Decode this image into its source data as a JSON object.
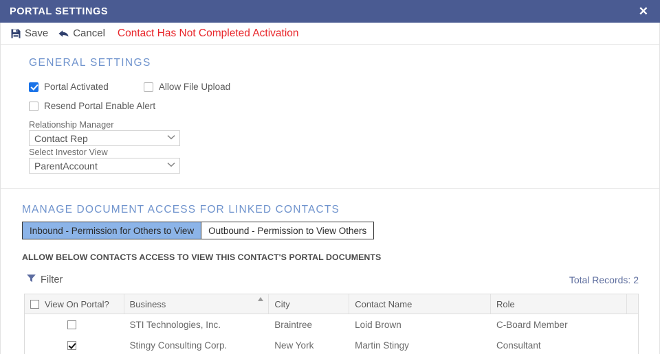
{
  "titlebar": {
    "title": "PORTAL SETTINGS",
    "close_icon": "close-icon",
    "close_glyph": "✕",
    "bg_color": "#4a5b92"
  },
  "toolbar": {
    "save_label": "Save",
    "save_icon": "save-floppy-icon",
    "cancel_label": "Cancel",
    "cancel_icon": "back-arrow-icon",
    "warning_text": "Contact Has Not Completed Activation",
    "warning_color": "#e8252a"
  },
  "general_settings": {
    "heading": "GENERAL SETTINGS",
    "heading_color": "#6f93cd",
    "portal_activated": {
      "label": "Portal Activated",
      "checked": true
    },
    "allow_file_upload": {
      "label": "Allow File Upload",
      "checked": false
    },
    "resend_portal_enable_alert": {
      "label": "Resend Portal Enable Alert",
      "checked": false
    },
    "relationship_manager": {
      "label": "Relationship Manager",
      "value": "Contact Rep"
    },
    "select_investor_view": {
      "label": "Select Investor View",
      "value": "ParentAccount"
    }
  },
  "manage_access": {
    "heading": "MANAGE DOCUMENT ACCESS FOR LINKED CONTACTS",
    "tabs": [
      {
        "label": "Inbound - Permission for Others to View",
        "active": true
      },
      {
        "label": "Outbound - Permission to View Others",
        "active": false
      }
    ],
    "active_tab_color": "#8cb4e8",
    "note": "ALLOW BELOW CONTACTS ACCESS TO VIEW THIS CONTACT'S PORTAL DOCUMENTS",
    "filter": {
      "label": "Filter",
      "icon": "filter-funnel-icon",
      "color": "#5d6d9e"
    },
    "total_records": "Total Records: 2",
    "table": {
      "columns": [
        "View On Portal?",
        "Business",
        "City",
        "Contact Name",
        "Role"
      ],
      "sorted_column": "Business",
      "sort_direction": "asc",
      "header_checkbox_checked": false,
      "rows": [
        {
          "view_on_portal": false,
          "business": "STI Technologies, Inc.",
          "city": "Braintree",
          "contact_name": "Loid Brown",
          "role": "C-Board Member"
        },
        {
          "view_on_portal": true,
          "business": "Stingy Consulting Corp.",
          "city": "New York",
          "contact_name": "Martin Stingy",
          "role": "Consultant"
        }
      ]
    }
  }
}
